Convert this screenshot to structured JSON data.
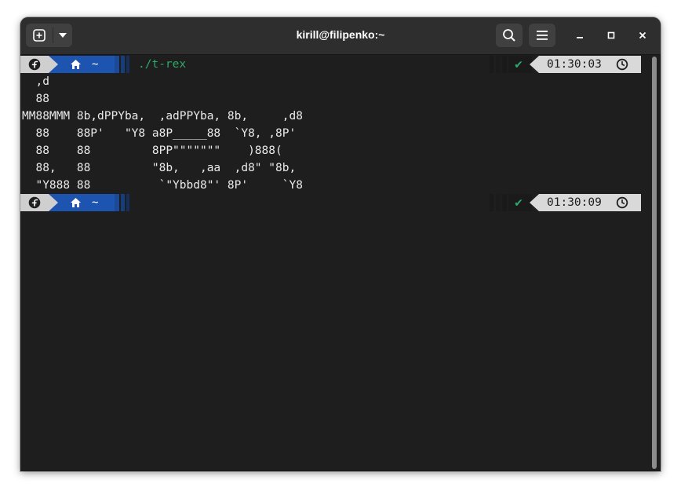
{
  "window": {
    "title": "kirill@filipenko:~"
  },
  "headerbar": {
    "new_tab_icon": "plus-square-icon",
    "dropdown_icon": "chevron-down-icon",
    "search_icon": "search-icon",
    "menu_icon": "hamburger-menu-icon",
    "minimize_icon": "minimize-icon",
    "maximize_icon": "maximize-icon",
    "close_icon": "close-icon"
  },
  "colors": {
    "terminal_bg": "#1e1e1e",
    "prompt_dir_bg": "#1c54b0",
    "command_green": "#2fa86a",
    "time_bg": "#d9d9d9",
    "text": "#eaeaea"
  },
  "prompts": [
    {
      "os_icon": "fedora-icon",
      "home_icon": "home-icon",
      "dir": "~",
      "command": "./t-rex",
      "status": "✔",
      "time": "01:30:03",
      "clock_icon": "clock-icon"
    },
    {
      "os_icon": "fedora-icon",
      "home_icon": "home-icon",
      "dir": "~",
      "command": "",
      "status": "✔",
      "time": "01:30:09",
      "clock_icon": "clock-icon"
    }
  ],
  "output_lines": [
    "  ,d",
    "  88",
    "MM88MMM 8b,dPPYba,  ,adPPYba, 8b,     ,d8",
    "  88    88P'   \"Y8 a8P_____88  `Y8, ,8P'",
    "  88    88         8PP\"\"\"\"\"\"\"    )888(",
    "  88,   88         \"8b,   ,aa  ,d8\" \"8b,",
    "  \"Y888 88          `\"Ybbd8\"' 8P'     `Y8"
  ]
}
